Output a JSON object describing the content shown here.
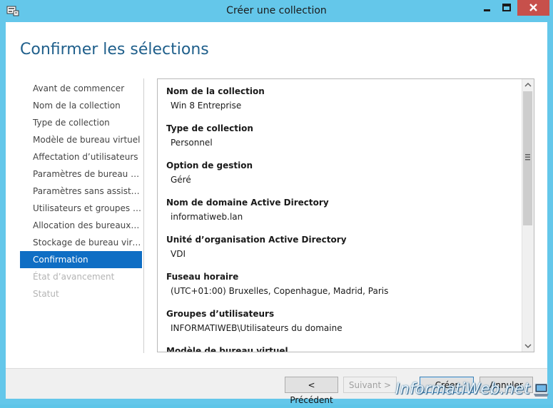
{
  "window": {
    "title": "Créer une collection",
    "icon": "server-manager-icon"
  },
  "page": {
    "heading": "Confirmer les sélections"
  },
  "nav": {
    "items": [
      {
        "label": "Avant de commencer",
        "state": "normal"
      },
      {
        "label": "Nom de la collection",
        "state": "normal"
      },
      {
        "label": "Type de collection",
        "state": "normal"
      },
      {
        "label": "Modèle de bureau virtuel",
        "state": "normal"
      },
      {
        "label": "Affectation d’utilisateurs",
        "state": "normal"
      },
      {
        "label": "Paramètres de bureau virt...",
        "state": "normal"
      },
      {
        "label": "Paramètres sans assistance",
        "state": "normal"
      },
      {
        "label": "Utilisateurs et groupes d’...",
        "state": "normal"
      },
      {
        "label": "Allocation des bureaux vir...",
        "state": "normal"
      },
      {
        "label": "Stockage de bureau virtuel",
        "state": "normal"
      },
      {
        "label": "Confirmation",
        "state": "active"
      },
      {
        "label": "État d’avancement",
        "state": "disabled"
      },
      {
        "label": "Statut",
        "state": "disabled"
      }
    ]
  },
  "summary": {
    "fields": [
      {
        "label": "Nom de la collection",
        "value": "Win 8 Entreprise"
      },
      {
        "label": "Type de collection",
        "value": "Personnel"
      },
      {
        "label": "Option de gestion",
        "value": "Géré"
      },
      {
        "label": "Nom de domaine Active Directory",
        "value": "informatiweb.lan"
      },
      {
        "label": "Unité d’organisation Active Directory",
        "value": "VDI"
      },
      {
        "label": "Fuseau horaire",
        "value": "(UTC+01:00) Bruxelles, Copenhague, Madrid, Paris"
      },
      {
        "label": "Groupes d’utilisateurs",
        "value": "INFORMATIWEB\\Utilisateurs du domaine"
      },
      {
        "label": "Modèle de bureau virtuel",
        "value": ""
      }
    ]
  },
  "footer": {
    "prev_label": "< Précédent",
    "next_label": "Suivant >",
    "create_label": "Créer",
    "cancel_label": "Annuler"
  },
  "watermark": {
    "text": "InformatiWeb.net"
  },
  "colors": {
    "titlebar": "#64c7ea",
    "close_button": "#c7504b",
    "heading": "#1f5f8b",
    "nav_active": "#0f6ec4"
  }
}
